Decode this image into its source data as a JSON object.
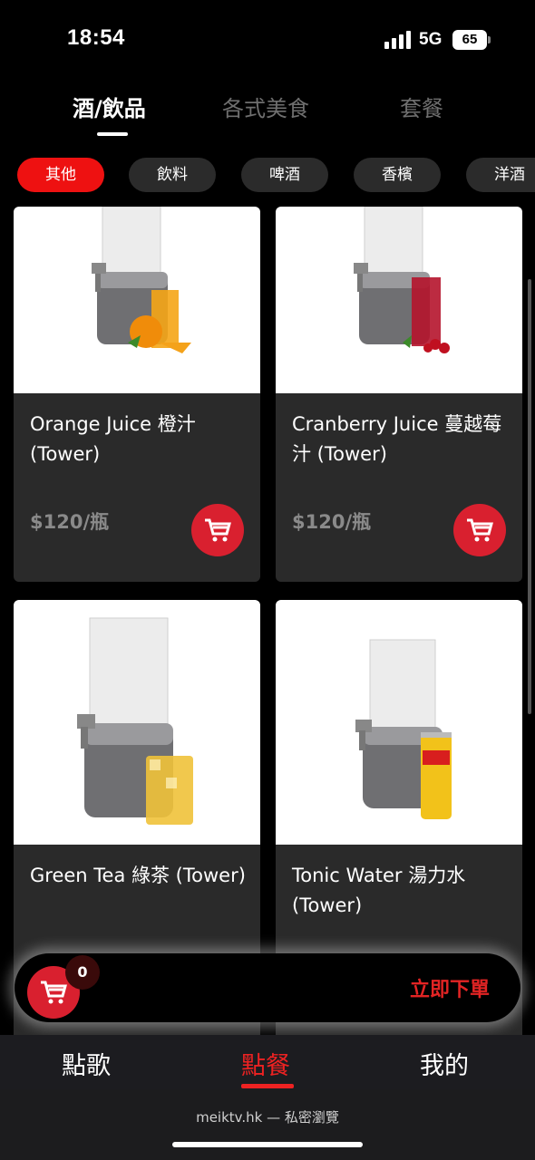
{
  "status": {
    "time": "18:54",
    "network": "5G",
    "battery": "65"
  },
  "top_tabs": [
    "酒/飲品",
    "各式美食",
    "套餐"
  ],
  "chips": [
    "其他",
    "飲料",
    "啤酒",
    "香檳",
    "洋酒"
  ],
  "products": [
    {
      "name": "Orange Juice 橙汁 (Tower)",
      "price": "$120/瓶",
      "drink_color": "#f5a516"
    },
    {
      "name": "Cranberry Juice 蔓越莓汁 (Tower)",
      "price": "$120/瓶",
      "drink_color": "#b5142c"
    },
    {
      "name": "Green Tea 綠茶 (Tower)",
      "drink_color": "#f0c23a"
    },
    {
      "name": "Tonic Water 湯力水 (Tower)",
      "drink_color": "#f2c21a"
    }
  ],
  "order_bar": {
    "count": "0",
    "label": "立即下單"
  },
  "bottom_nav": [
    "點歌",
    "點餐",
    "我的"
  ],
  "browser": {
    "url": "meiktv.hk — 私密瀏覽"
  },
  "colors": {
    "accent": "#ee1111",
    "card_bg": "#2a2a2a"
  }
}
